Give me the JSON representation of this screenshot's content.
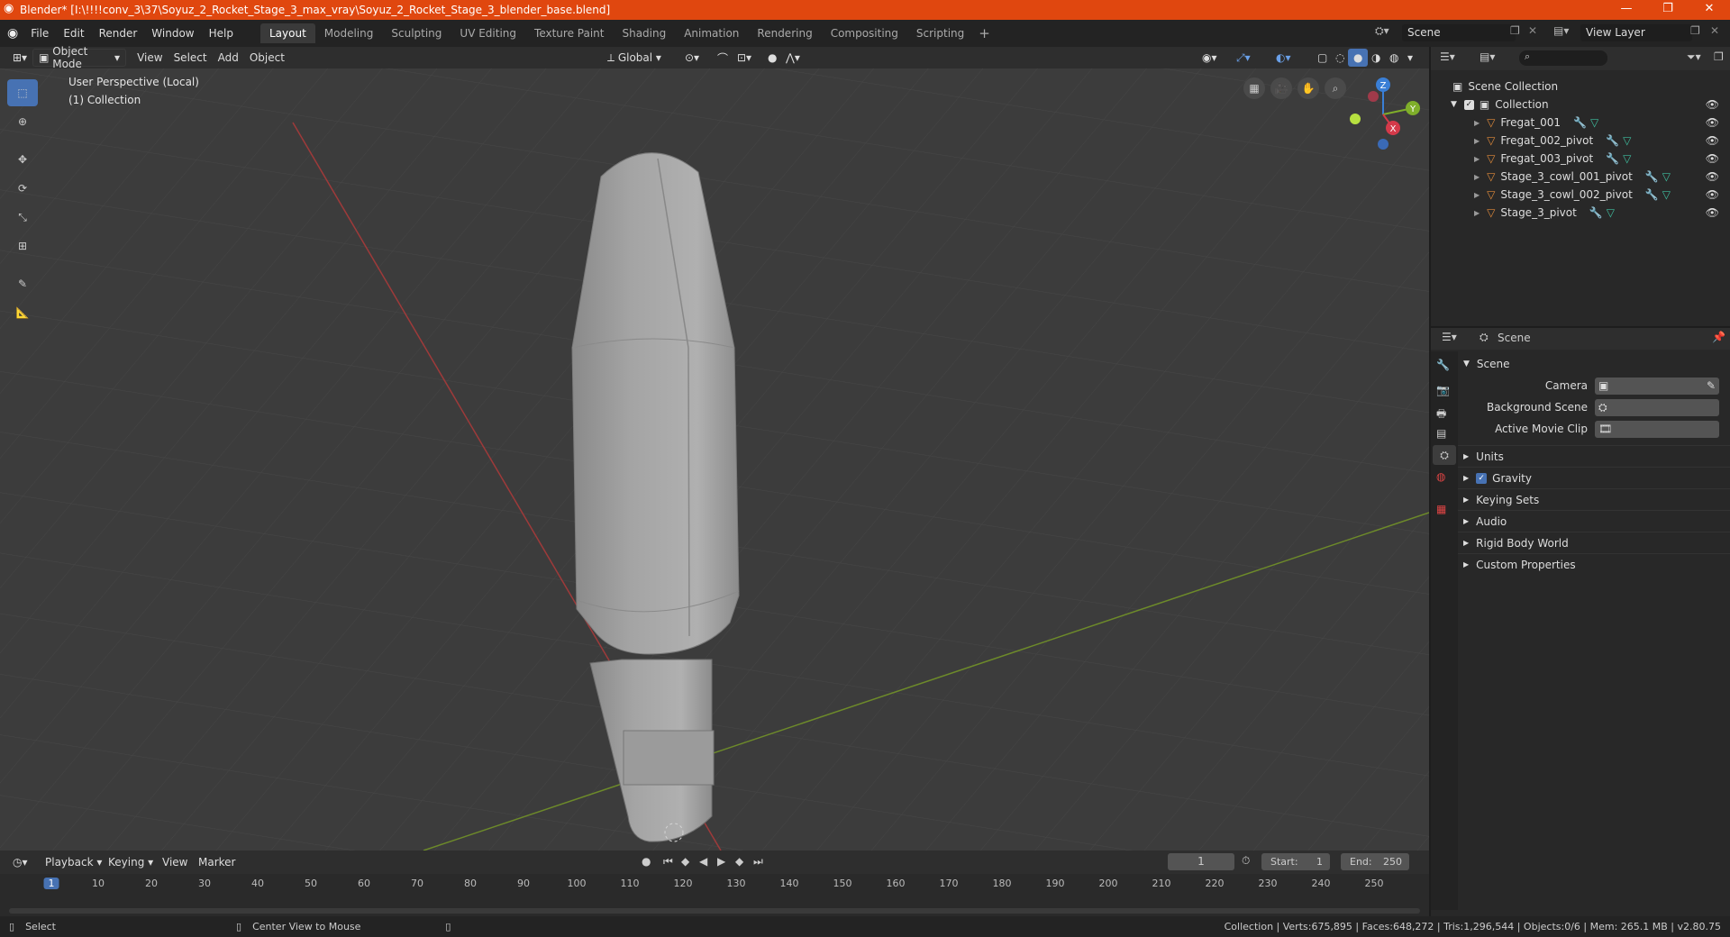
{
  "window": {
    "title": "Blender* [I:\\!!!!conv_3\\37\\Soyuz_2_Rocket_Stage_3_max_vray\\Soyuz_2_Rocket_Stage_3_blender_base.blend]"
  },
  "menu": {
    "items": [
      "File",
      "Edit",
      "Render",
      "Window",
      "Help"
    ]
  },
  "workspaces": [
    "Layout",
    "Modeling",
    "Sculpting",
    "UV Editing",
    "Texture Paint",
    "Shading",
    "Animation",
    "Rendering",
    "Compositing",
    "Scripting"
  ],
  "top_right": {
    "scene": "Scene",
    "view_layer": "View Layer"
  },
  "viewport_header": {
    "mode": "Object Mode",
    "menus": [
      "View",
      "Select",
      "Add",
      "Object"
    ],
    "orientation": "Global"
  },
  "viewport": {
    "perspective": "User Perspective (Local)",
    "collection": "(1) Collection",
    "gizmo": {
      "x": "X",
      "y": "Y",
      "z": "Z"
    }
  },
  "outliner": {
    "root": "Scene Collection",
    "collection": "Collection",
    "objects": [
      "Fregat_001",
      "Fregat_002_pivot",
      "Fregat_003_pivot",
      "Stage_3_cowl_001_pivot",
      "Stage_3_cowl_002_pivot",
      "Stage_3_pivot"
    ]
  },
  "properties": {
    "header": "Scene",
    "panel": "Scene",
    "fields": [
      {
        "label": "Camera"
      },
      {
        "label": "Background Scene"
      },
      {
        "label": "Active Movie Clip"
      }
    ],
    "sections": [
      "Units",
      "Gravity",
      "Keying Sets",
      "Audio",
      "Rigid Body World",
      "Custom Properties"
    ]
  },
  "timeline": {
    "menus": [
      "Playback",
      "Keying",
      "View",
      "Marker"
    ],
    "current_frame": "1",
    "start_label": "Start:",
    "start": "1",
    "end_label": "End:",
    "end": "250",
    "ticks": [
      "1",
      "10",
      "20",
      "30",
      "40",
      "50",
      "60",
      "70",
      "80",
      "90",
      "100",
      "110",
      "120",
      "130",
      "140",
      "150",
      "160",
      "170",
      "180",
      "190",
      "200",
      "210",
      "220",
      "230",
      "240",
      "250"
    ]
  },
  "statusbar": {
    "select": "Select",
    "center": "Center View to Mouse",
    "stats": "Collection | Verts:675,895 | Faces:648,272 | Tris:1,296,544 | Objects:0/6 | Mem: 265.1 MB | v2.80.75"
  },
  "colors": {
    "accent": "#4772b3",
    "titlebar": "#e0470f",
    "object_icon": "#e08a3a",
    "mesh_icon": "#3fbfa0",
    "modifier_icon": "#6aa0e8"
  }
}
